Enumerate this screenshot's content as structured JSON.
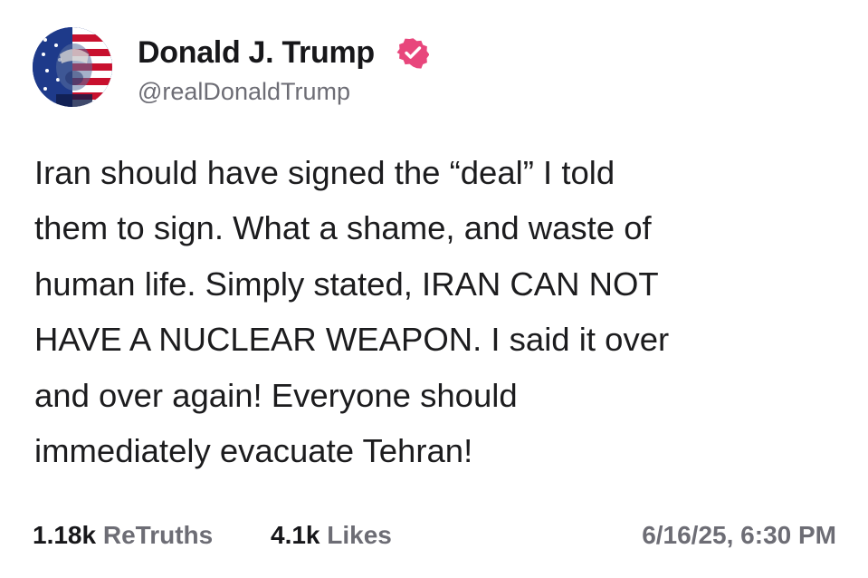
{
  "author": {
    "display_name": "Donald J. Trump",
    "handle": "@realDonaldTrump",
    "verified": true,
    "verified_color": "#e8467c"
  },
  "post": {
    "lines": [
      "Iran should have signed the “deal” I told",
      "them to sign. What a shame, and waste of",
      "human life. Simply stated, IRAN CAN NOT",
      "HAVE A NUCLEAR WEAPON. I said it over",
      "and over again! Everyone should",
      "immediately evacuate Tehran!"
    ]
  },
  "stats": {
    "retruths_count": "1.18k",
    "retruths_label": "ReTruths",
    "likes_count": "4.1k",
    "likes_label": "Likes",
    "timestamp": "6/16/25, 6:30 PM"
  },
  "icons": {
    "avatar": "avatar-image",
    "verified": "verified-badge-icon"
  }
}
